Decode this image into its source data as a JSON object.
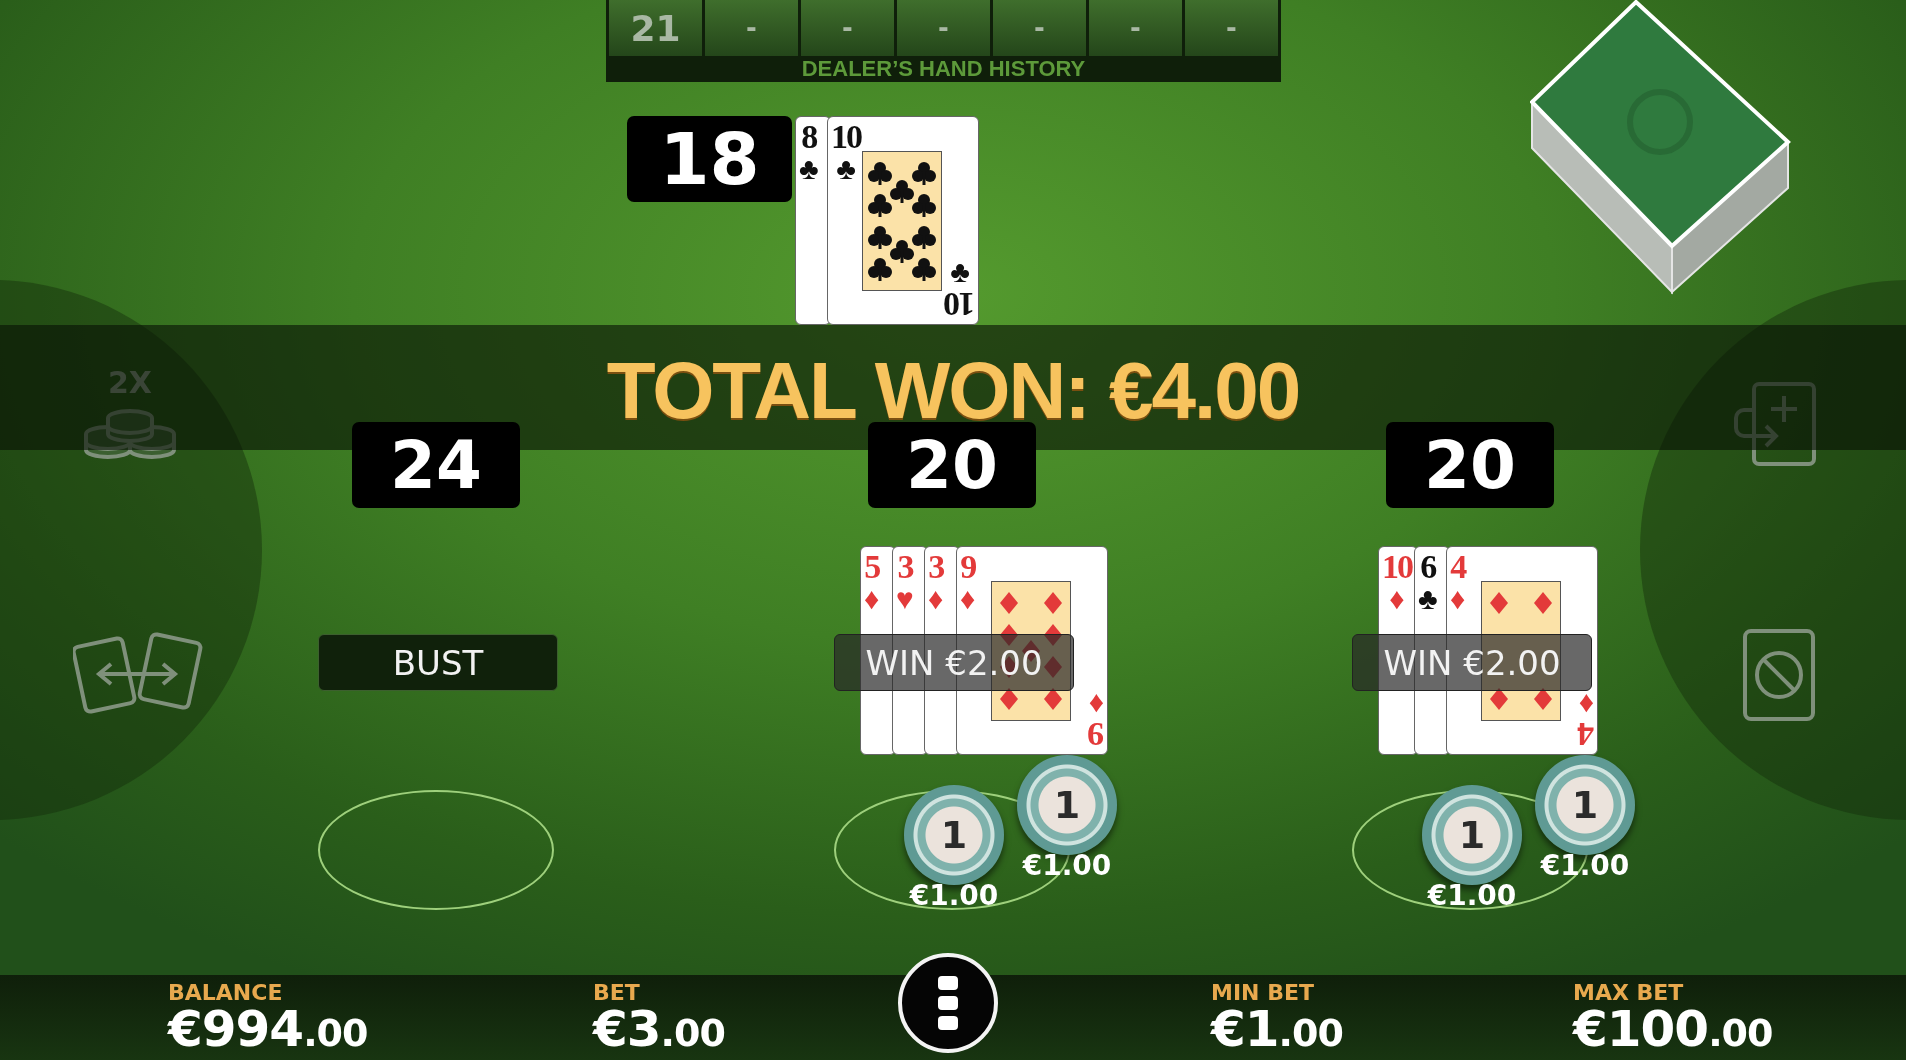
{
  "history": {
    "entries": [
      "21",
      "-",
      "-",
      "-",
      "-",
      "-",
      "-"
    ],
    "label": "DEALER’S HAND HISTORY"
  },
  "dealer": {
    "score": "18",
    "cards": [
      {
        "rank": "8",
        "suit": "♣",
        "kind": "clubs"
      },
      {
        "rank": "10",
        "suit": "♣",
        "kind": "clubs",
        "bottom": {
          "rank": "10",
          "suit": "♣"
        }
      }
    ]
  },
  "banner": "TOTAL WON: €4.00",
  "side_buttons": [
    {
      "kind": "double",
      "label": "2X"
    },
    {
      "kind": "swap"
    },
    {
      "kind": "split"
    },
    {
      "kind": "stop"
    }
  ],
  "hands": [
    {
      "score": "24",
      "result": {
        "kind": "bust",
        "text": "BUST"
      }
    },
    {
      "score": "20",
      "result": {
        "kind": "win",
        "text": "WIN €2.00"
      },
      "cards": [
        {
          "rank": "5",
          "suit": "♦",
          "kind": "diamonds"
        },
        {
          "rank": "3",
          "suit": "♥",
          "kind": "hearts"
        },
        {
          "rank": "3",
          "suit": "♦",
          "kind": "diamonds"
        },
        {
          "rank": "9",
          "suit": "♦",
          "kind": "diamonds",
          "bottom": {
            "rank": "9",
            "suit": "♦"
          }
        }
      ],
      "chips": [
        {
          "value": "1",
          "amount": "€1.00"
        },
        {
          "value": "1",
          "amount": "€1.00"
        }
      ]
    },
    {
      "score": "20",
      "result": {
        "kind": "win",
        "text": "WIN €2.00"
      },
      "cards": [
        {
          "rank": "10",
          "suit": "♦",
          "kind": "diamonds"
        },
        {
          "rank": "6",
          "suit": "♣",
          "kind": "clubs"
        },
        {
          "rank": "4",
          "suit": "♦",
          "kind": "diamonds",
          "bottom": {
            "rank": "4",
            "suit": "♦"
          }
        }
      ],
      "chips": [
        {
          "value": "1",
          "amount": "€1.00"
        },
        {
          "value": "1",
          "amount": "€1.00"
        }
      ]
    }
  ],
  "stats": [
    {
      "label": "BALANCE",
      "amount": "€994",
      "cents": ".00"
    },
    {
      "label": "BET",
      "amount": "€3",
      "cents": ".00"
    },
    {
      "label": "MIN BET",
      "amount": "€1",
      "cents": ".00"
    },
    {
      "label": "MAX BET",
      "amount": "€100",
      "cents": ".00"
    }
  ]
}
